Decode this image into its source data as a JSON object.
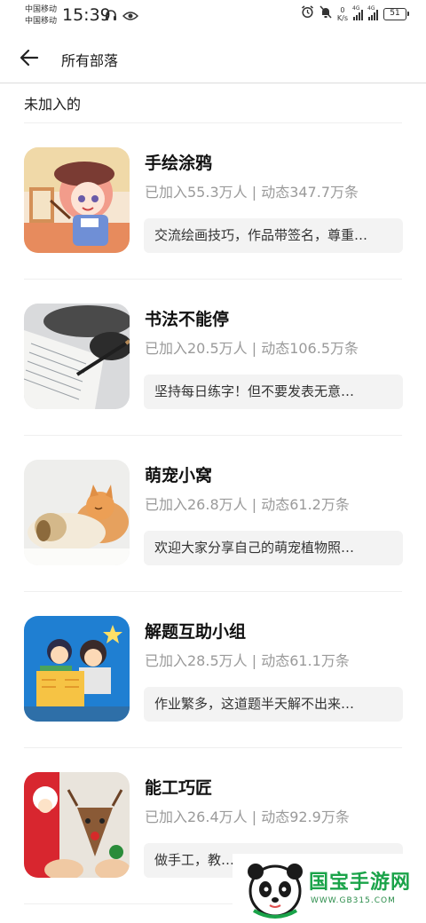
{
  "status_bar": {
    "carrier_1": "中国移动",
    "carrier_2": "中国移动",
    "time": "15:39",
    "net_speed_value": "0",
    "net_speed_unit": "K/s",
    "signal_tag_1": "4G",
    "signal_tag_2": "4G",
    "battery": "51"
  },
  "header": {
    "title": "所有部落"
  },
  "section": {
    "label": "未加入的"
  },
  "tribes": [
    {
      "name": "手绘涂鸦",
      "stats": "已加入55.3万人 | 动态347.7万条",
      "desc": "交流绘画技巧，作品带签名，尊重…",
      "icon": "anime-painter-thumbnail"
    },
    {
      "name": "书法不能停",
      "stats": "已加入20.5万人 | 动态106.5万条",
      "desc": "坚持每日练字！但不要发表无意…",
      "icon": "calligraphy-thumbnail"
    },
    {
      "name": "萌宠小窝",
      "stats": "已加入26.8万人 | 动态61.2万条",
      "desc": "欢迎大家分享自己的萌宠植物照…",
      "icon": "pets-thumbnail"
    },
    {
      "name": "解题互助小组",
      "stats": "已加入28.5万人 | 动态61.1万条",
      "desc": "作业繁多，这道题半天解不出来…",
      "icon": "study-thumbnail"
    },
    {
      "name": "能工巧匠",
      "stats": "已加入26.4万人 | 动态92.9万条",
      "desc": "做手工，教…",
      "icon": "crafts-thumbnail"
    }
  ],
  "watermark": {
    "text": "国宝手游网",
    "url": "WWW.GB315.COM"
  },
  "colors": {
    "stats_text": "#9a9a9a",
    "desc_bg": "#f3f3f3",
    "watermark_green": "#1aa349"
  }
}
